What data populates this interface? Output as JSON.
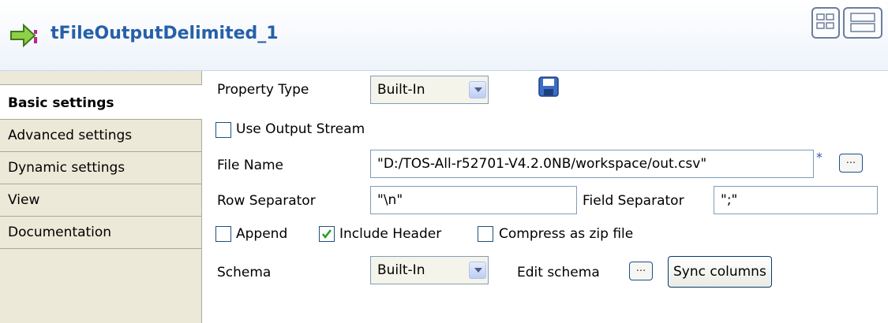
{
  "header": {
    "title": "tFileOutputDelimited_1",
    "icon": "file-output-arrow-icon",
    "view_buttons": [
      "grid-view-icon",
      "list-view-icon"
    ]
  },
  "sidebar": {
    "items": [
      {
        "label": "Basic settings",
        "active": true
      },
      {
        "label": "Advanced settings",
        "active": false
      },
      {
        "label": "Dynamic settings",
        "active": false
      },
      {
        "label": "View",
        "active": false
      },
      {
        "label": "Documentation",
        "active": false
      }
    ]
  },
  "form": {
    "property_type": {
      "label": "Property Type",
      "value": "Built-In"
    },
    "use_output_stream": {
      "label": "Use Output Stream",
      "checked": false
    },
    "file_name": {
      "label": "File Name",
      "value": "\"D:/TOS-All-r52701-V4.2.0NB/workspace/out.csv\"",
      "required_marker": "*",
      "browse_label": "..."
    },
    "row_separator": {
      "label": "Row Separator",
      "value": "\"\\n\""
    },
    "field_separator": {
      "label": "Field Separator",
      "value": "\";\""
    },
    "append": {
      "label": "Append",
      "checked": false
    },
    "include_header": {
      "label": "Include Header",
      "checked": true
    },
    "compress_zip": {
      "label": "Compress as zip file",
      "checked": false
    },
    "schema": {
      "label": "Schema",
      "value": "Built-In"
    },
    "edit_schema": {
      "label": "Edit schema",
      "button_label": "..."
    },
    "sync_columns": {
      "label": "Sync columns"
    }
  },
  "colors": {
    "title": "#2660a8",
    "sidebar_bg": "#ece9d8",
    "field_border": "#7f9db9"
  }
}
